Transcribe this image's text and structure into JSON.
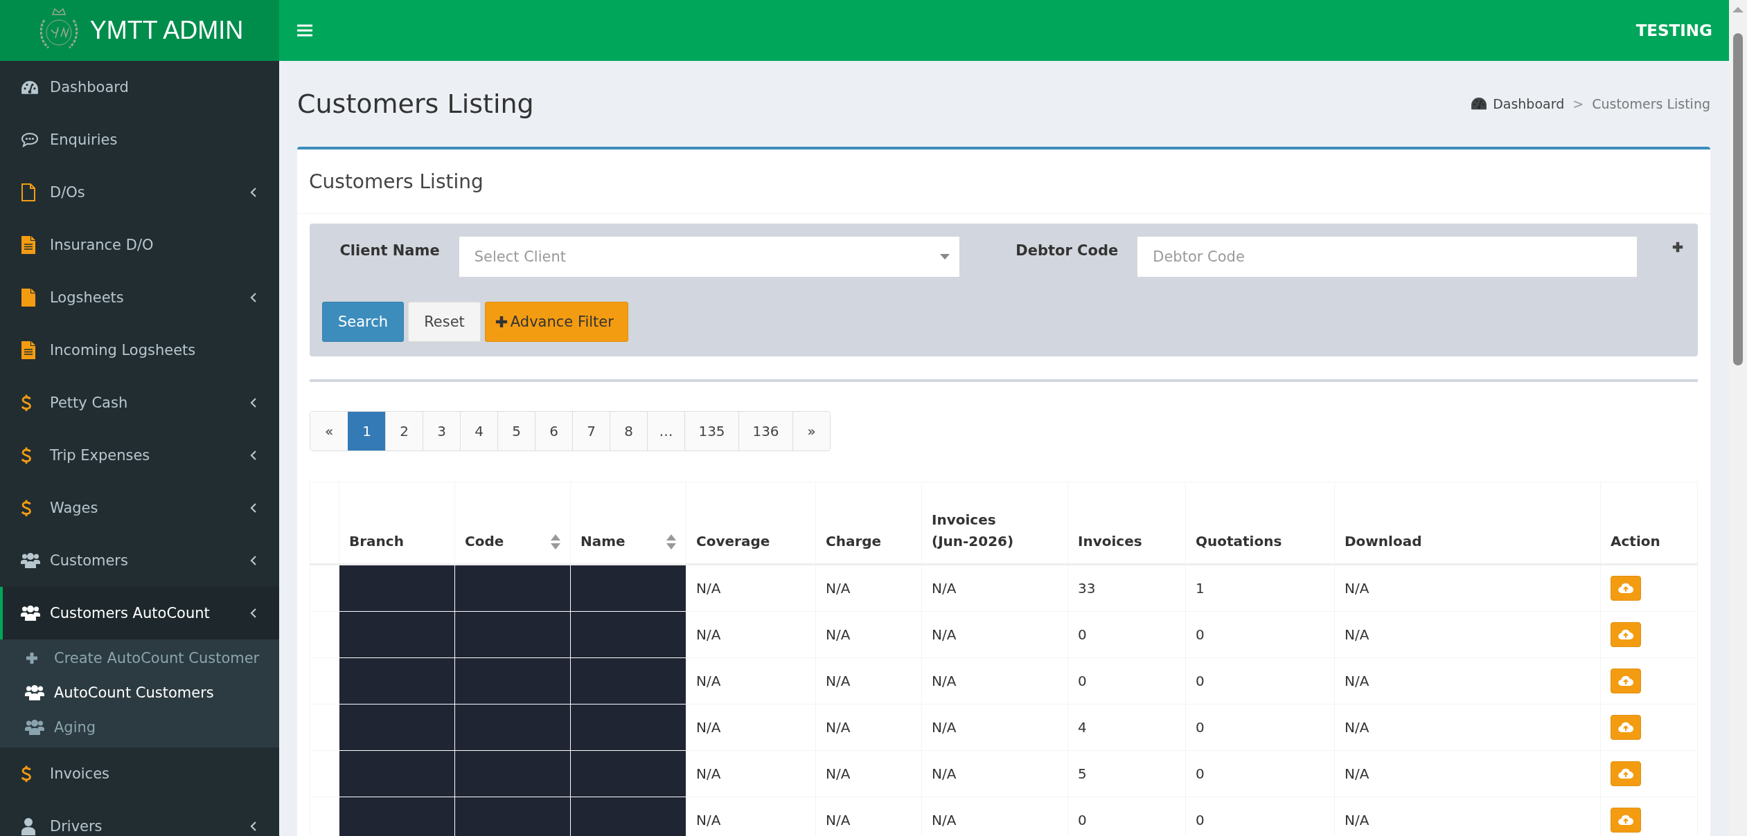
{
  "header": {
    "logo_text": "YMTT ADMIN",
    "env_label": "TESTING"
  },
  "sidebar": {
    "items": [
      {
        "label": "Dashboard",
        "has_submenu": false,
        "selected": false
      },
      {
        "label": "Enquiries",
        "has_submenu": false,
        "selected": false
      },
      {
        "label": "D/Os",
        "has_submenu": true,
        "selected": false
      },
      {
        "label": "Insurance D/O",
        "has_submenu": false,
        "selected": false
      },
      {
        "label": "Logsheets",
        "has_submenu": true,
        "selected": false
      },
      {
        "label": "Incoming Logsheets",
        "has_submenu": false,
        "selected": false
      },
      {
        "label": "Petty Cash",
        "has_submenu": true,
        "selected": false
      },
      {
        "label": "Trip Expenses",
        "has_submenu": true,
        "selected": false
      },
      {
        "label": "Wages",
        "has_submenu": true,
        "selected": false
      },
      {
        "label": "Customers",
        "has_submenu": true,
        "selected": false
      },
      {
        "label": "Customers AutoCount",
        "has_submenu": true,
        "selected": true,
        "children": [
          {
            "label": "Create AutoCount Customer",
            "selected": false
          },
          {
            "label": "AutoCount Customers",
            "selected": true
          },
          {
            "label": "Aging",
            "selected": false
          }
        ]
      },
      {
        "label": "Invoices",
        "has_submenu": false,
        "selected": false
      },
      {
        "label": "Drivers",
        "has_submenu": true,
        "selected": false
      }
    ]
  },
  "page": {
    "title": "Customers Listing",
    "breadcrumb": [
      {
        "label": "Dashboard",
        "kind": "home"
      },
      {
        "label": ">",
        "kind": "separator"
      },
      {
        "label": "Customers Listing",
        "kind": "current"
      }
    ]
  },
  "box": {
    "title": "Customers Listing",
    "filters": [
      {
        "label": "Client Name",
        "placeholder": "Select Client",
        "kind": "select"
      },
      {
        "label": "Debtor Code",
        "placeholder": "Debtor Code",
        "kind": "text"
      }
    ],
    "buttons": [
      {
        "label": "Search",
        "kind": "primary"
      },
      {
        "label": "Reset",
        "kind": "default"
      },
      {
        "label": "Advance Filter",
        "kind": "warning"
      }
    ],
    "pagination": [
      {
        "label": "«",
        "selected": false
      },
      {
        "label": "1",
        "selected": true
      },
      {
        "label": "2",
        "selected": false
      },
      {
        "label": "3",
        "selected": false
      },
      {
        "label": "4",
        "selected": false
      },
      {
        "label": "5",
        "selected": false
      },
      {
        "label": "6",
        "selected": false
      },
      {
        "label": "7",
        "selected": false
      },
      {
        "label": "8",
        "selected": false
      },
      {
        "label": "…",
        "selected": false
      },
      {
        "label": "135",
        "selected": false
      },
      {
        "label": "136",
        "selected": false
      },
      {
        "label": "»",
        "selected": false
      }
    ],
    "table": {
      "columns": [
        {
          "label": "Branch",
          "sortable": false
        },
        {
          "label": "Code",
          "sortable": true
        },
        {
          "label": "Name",
          "sortable": true
        },
        {
          "label": "Coverage",
          "sortable": false
        },
        {
          "label": "Charge",
          "sortable": false
        },
        {
          "label": "Invoices\n(Jun-2026)",
          "sortable": false
        },
        {
          "label": "Invoices",
          "sortable": false
        },
        {
          "label": "Quotations",
          "sortable": false
        },
        {
          "label": "Download",
          "sortable": false
        },
        {
          "label": "Action",
          "sortable": false
        }
      ],
      "rows": [
        {
          "redacted": true,
          "cells": [
            "",
            "",
            "",
            "N/A",
            "N/A",
            "N/A",
            "33",
            "1",
            "N/A"
          ]
        },
        {
          "redacted": true,
          "cells": [
            "",
            "",
            "",
            "N/A",
            "N/A",
            "N/A",
            "0",
            "0",
            "N/A"
          ]
        },
        {
          "redacted": true,
          "cells": [
            "",
            "",
            "",
            "N/A",
            "N/A",
            "N/A",
            "0",
            "0",
            "N/A"
          ]
        },
        {
          "redacted": true,
          "cells": [
            "",
            "",
            "",
            "N/A",
            "N/A",
            "N/A",
            "4",
            "0",
            "N/A"
          ]
        },
        {
          "redacted": true,
          "cells": [
            "",
            "",
            "",
            "N/A",
            "N/A",
            "N/A",
            "5",
            "0",
            "N/A"
          ]
        },
        {
          "redacted": true,
          "cells": [
            "",
            "",
            "",
            "N/A",
            "N/A",
            "N/A",
            "0",
            "0",
            "N/A"
          ]
        }
      ]
    }
  }
}
